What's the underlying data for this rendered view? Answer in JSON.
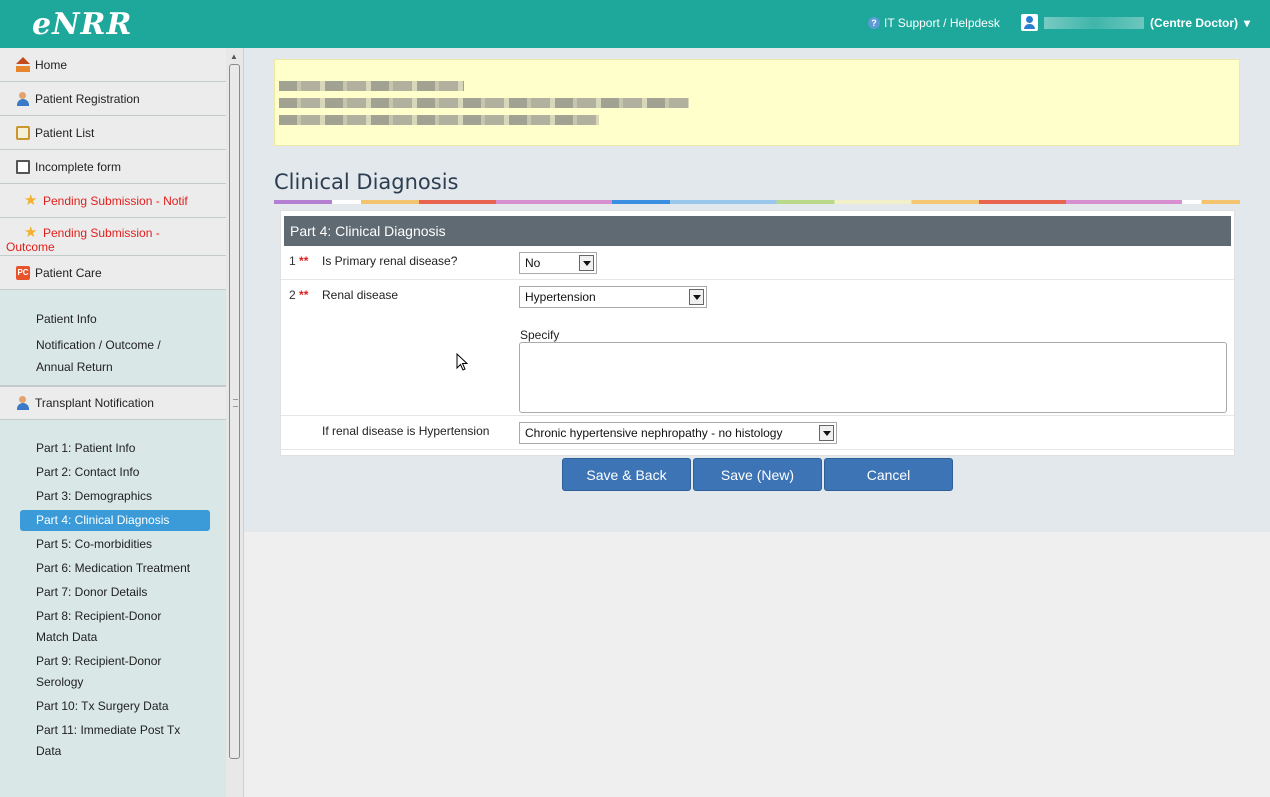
{
  "app": {
    "logo": "eNRR"
  },
  "header": {
    "help_label": "IT Support / Helpdesk",
    "user_role": "(Centre Doctor)",
    "user_role_caret": "▾"
  },
  "sidebar": {
    "items": [
      {
        "label": "Home",
        "icon": "home-icon"
      },
      {
        "label": "Patient Registration",
        "icon": "person-icon"
      },
      {
        "label": "Patient List",
        "icon": "list-icon"
      },
      {
        "label": "Incomplete form",
        "icon": "clipboard-icon"
      },
      {
        "label": "Pending Submission - Notif",
        "icon": "star-icon"
      },
      {
        "label_line1": "Pending Submission -",
        "label_line2": "Outcome",
        "icon": "star-icon"
      },
      {
        "label": "Patient Care",
        "icon": "pc-icon"
      }
    ],
    "patient_care_sub": [
      "Patient Info",
      "Notification / Outcome /",
      "Annual Return"
    ],
    "transplant_label": "Transplant Notification",
    "transplant_sub": [
      "Part 1: Patient Info",
      "Part 2: Contact Info",
      "Part 3: Demographics",
      "Part 4: Clinical Diagnosis",
      "Part 5: Co-morbidities",
      "Part 6: Medication Treatment",
      "Part 7: Donor Details",
      "Part 8: Recipient-Donor",
      "Match Data",
      "Part 9: Recipient-Donor",
      "Serology",
      "Part 10: Tx Surgery Data",
      "Part 11: Immediate Post Tx",
      "Data"
    ]
  },
  "page": {
    "title": "Clinical Diagnosis",
    "section_title": "Part 4: Clinical Diagnosis"
  },
  "form": {
    "q1": {
      "num": "1",
      "req": "**",
      "label": "Is Primary renal disease?",
      "value": "No"
    },
    "q2": {
      "num": "2",
      "req": "**",
      "label": "Renal disease",
      "value": "Hypertension",
      "specify_label": "Specify",
      "specify_value": ""
    },
    "q3": {
      "label": "If renal disease is Hypertension",
      "value": "Chronic hypertensive nephropathy - no histology"
    }
  },
  "buttons": {
    "save_back": "Save & Back",
    "save_new": "Save (New)",
    "cancel": "Cancel"
  },
  "colors": {
    "header": "#1ea89b",
    "button": "#3d74b6",
    "active_nav": "#3b9bd8",
    "required": "#e02020"
  }
}
